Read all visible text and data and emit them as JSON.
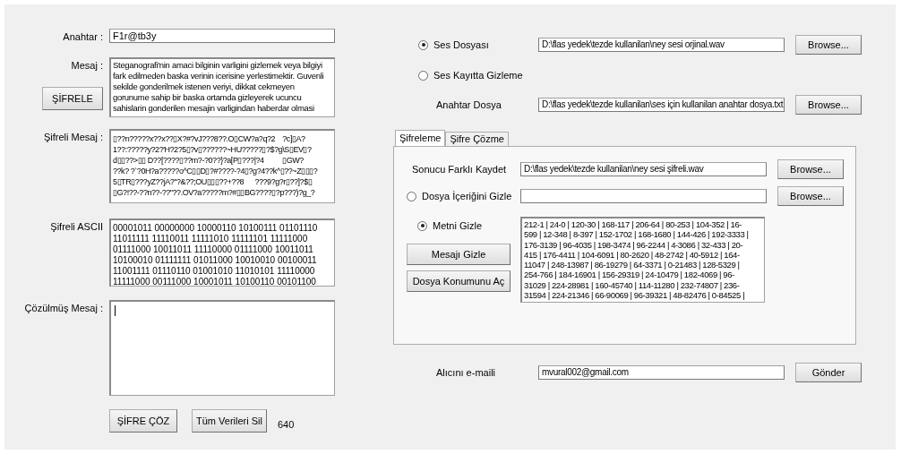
{
  "left": {
    "key": {
      "label": "Anahtar :",
      "value": "F1r@tb3y"
    },
    "message": {
      "label": "Mesaj :",
      "lines": [
        "Steganografi'nin amaci bilginin varligini gizlemek veya bilgiyi",
        "fark edilmeden baska verinin icerisine yerlestimektir. Guvenli",
        "sekilde gonderilmek istenen veriyi, dikkat cekmeyen",
        "gorunume sahip bir baska ortamda gizleyerek ucuncu",
        "sahislarin gonderilen mesajin varligindan haberdar olmasi"
      ]
    },
    "encrypt_button": "ŞİFRELE",
    "cipher_message": {
      "label": "Şifreli Mesaj :",
      "lines": [
        "▯??n?????x??x??▯X?#?vJ???8??.O▯CW?a?q?2    ?c]▯A?",
        "1??:?????y?2?'H?2?5▯?v▯??????~HU?????▯?$?g\\S▯EV▯?",
        "d▯▯??>▯▯ D??[????▯??m?-?0??}?a[P▯???|?4          ▯GW?",
        "??k? ?`?0H?a?????o^C▯▯D▯?#????-?4▯?g?4??k^▯??~Z▯▯▯?",
        "5▯TR▯???yZ??jA?\"?&??;OU▯▯▯??+??8      ???9?g?r▯??]?$▯",
        "▯G?!??-??n??-??\"??.OV?a?????m?#▯▯BG????▯?p???)?g_?"
      ]
    },
    "cipher_ascii": {
      "label": "Şifreli ASCII",
      "lines": [
        "00001011 00000000 10000110 10100111 01101110",
        "11011111 11110011 11111010 11111101 11111000",
        "01111000 10011011 11110000 01111000 10011011",
        "10100010 01111111 01011000 10010010 00100011",
        "11001111 01110110 01001010 11010101 11110000",
        "11111000 00111000 10001011 10100110 00101100"
      ]
    },
    "decoded_message": {
      "label": "Çözülmüş Mesaj :"
    },
    "buttons": [
      "ŞİFRE ÇÖZ",
      "Tüm Verileri Sil"
    ],
    "count": "640"
  },
  "source_options": [
    {
      "label": "Ses Dosyası",
      "selected": true,
      "path": "D:\\flas yedek\\tezde kullanilan\\ney sesi orjinal.wav",
      "button": "Browse..."
    },
    {
      "label": "Ses Kayıtta Gizleme",
      "selected": false
    }
  ],
  "key_file": {
    "label": "Anahtar Dosya",
    "path": "D:\\flas yedek\\tezde kullanilan\\ses için kullanilan anahtar dosya.txt",
    "button": "Browse..."
  },
  "tabs": [
    {
      "label": "Şifreleme",
      "selected": true
    },
    {
      "label": "Şifre Çözme",
      "selected": false
    }
  ],
  "save_as": {
    "label": "Sonucu Farklı Kaydet",
    "path": "D:\\flas yedek\\tezde kullanilan\\ney sesi şifreli.wav",
    "button": "Browse..."
  },
  "hide_modes": [
    {
      "label": "Dosya İçeriğini Gizle",
      "selected": false,
      "button": "Browse..."
    },
    {
      "label": "Metni Gizle",
      "selected": true
    }
  ],
  "hide_buttons": [
    "Mesajı Gizle",
    "Dosya Konumunu Aç"
  ],
  "output_lines": [
    "212-1 | 24-0 | 120-30 | 168-117 | 206-64 | 80-253 | 104-352 | 16-",
    "599 | 12-348 | 8-397 | 152-1702 | 168-1680 | 144-426 | 192-3333 |",
    "176-3139 | 96-4035 | 198-3474 | 96-2244 | 4-3086 | 32-433 | 20-",
    "415 | 176-4411 | 104-6091 | 80-2620 | 48-2742 | 40-5912 | 164-",
    "11047 | 248-13987 | 86-19279 | 64-3371 | 0-21483 | 128-5329 |",
    "254-766 | 184-16901 | 156-29319 | 24-10479 | 182-4069 | 96-",
    "31029 | 224-28981 | 160-45740 | 114-11280 | 232-74807 | 236-",
    "31594 | 224-21346 | 66-90069 | 96-39321 | 48-82476 | 0-84525 |"
  ],
  "email": {
    "label": "Alıcını e-maili",
    "value": "mvural002@gmail.com",
    "button": "Gönder"
  }
}
